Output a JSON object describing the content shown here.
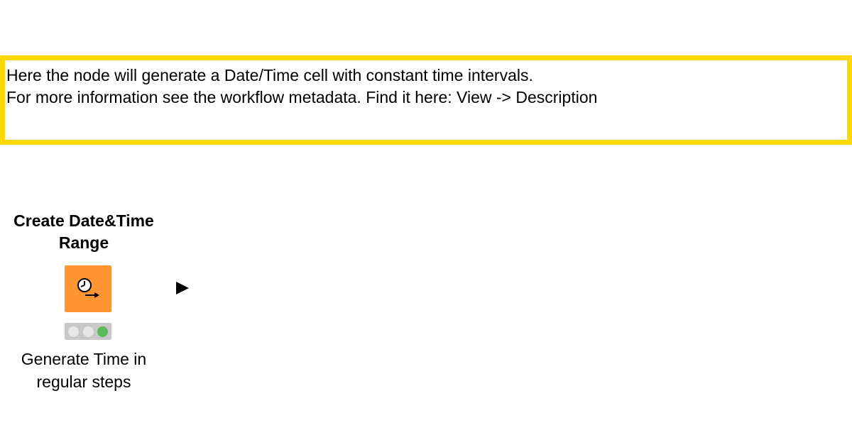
{
  "annotation": {
    "lines": [
      "Here the node will generate a Date/Time cell with constant time intervals.",
      "For more information see the workflow metadata. Find it here: View -> Description"
    ],
    "border_color": "#FFD800"
  },
  "node": {
    "title_line1": "Create Date&Time",
    "title_line2": "Range",
    "icon": "clock-arrow-icon",
    "color": "#FF9632",
    "status": "executed",
    "status_color": "#5CB85C",
    "label_line1": "Generate Time in",
    "label_line2": "regular steps"
  }
}
